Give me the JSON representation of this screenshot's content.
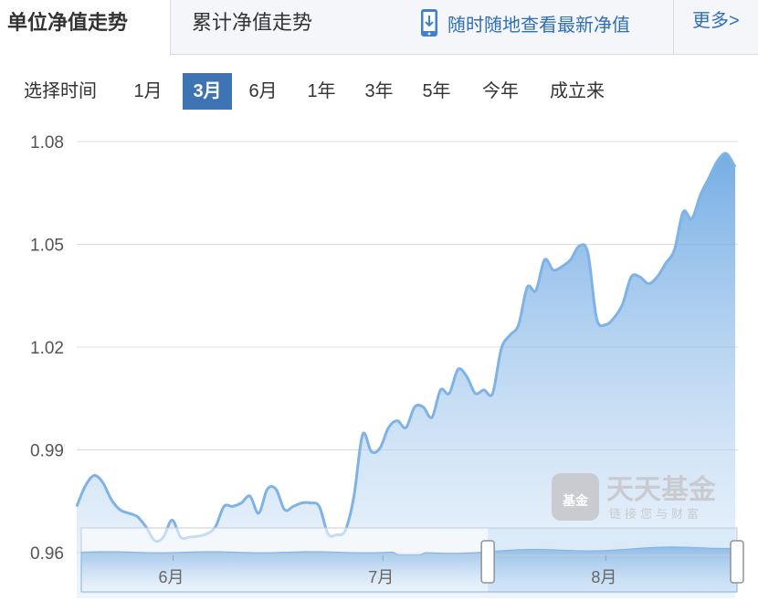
{
  "tabs": [
    {
      "label": "单位净值走势"
    },
    {
      "label": "累计净值走势"
    }
  ],
  "app_link": {
    "label": "随时随地查看最新净值",
    "icon": "phone-download-icon"
  },
  "more": {
    "label": "更多>"
  },
  "time_selector": {
    "label": "选择时间",
    "options": [
      "1月",
      "3月",
      "6月",
      "1年",
      "3年",
      "5年",
      "今年",
      "成立来"
    ],
    "selected": "3月"
  },
  "watermark": {
    "title": "天天基金",
    "slogan": "链接您与财富",
    "badge": "基金"
  },
  "colors": {
    "line": "#7fb2e5",
    "area_top": "#5d9fe0",
    "selected": "#3e74b3",
    "link": "#2f6fb6"
  },
  "chart_data": {
    "type": "area",
    "title": "",
    "xlabel": "",
    "ylabel": "",
    "ylim": [
      0.955,
      1.085
    ],
    "yticks": [
      0.96,
      0.99,
      1.02,
      1.05,
      1.08
    ],
    "ytick_labels": [
      "0.96",
      "0.99",
      "1.02",
      "1.05",
      "1.08"
    ],
    "x_month_labels": [
      "6月",
      "7月",
      "8月"
    ],
    "grid": true,
    "series": [
      {
        "values": [
          0.9735,
          0.9795,
          0.9825,
          0.9805,
          0.9755,
          0.9725,
          0.9715,
          0.9705,
          0.9675,
          0.9635,
          0.9645,
          0.9695,
          0.9645,
          0.9645,
          0.9648,
          0.9655,
          0.9675,
          0.9735,
          0.9735,
          0.9745,
          0.9765,
          0.9715,
          0.9785,
          0.9785,
          0.9725,
          0.9735,
          0.9745,
          0.9745,
          0.9735,
          0.9655,
          0.9652,
          0.9665,
          0.9765,
          0.9945,
          0.9895,
          0.9905,
          0.9965,
          0.9985,
          0.9965,
          1.0025,
          1.0025,
          0.9995,
          1.0075,
          1.0065,
          1.0135,
          1.0115,
          1.0065,
          1.0075,
          1.0065,
          1.0195,
          1.0235,
          1.0265,
          1.0375,
          1.0365,
          1.0455,
          1.0425,
          1.0435,
          1.0455,
          1.0495,
          1.0475,
          1.0285,
          1.0265,
          1.0285,
          1.0325,
          1.0405,
          1.0405,
          1.0385,
          1.0405,
          1.0445,
          1.0485,
          1.0595,
          1.0575,
          1.0645,
          1.0695,
          1.0745,
          1.0765,
          1.0725
        ]
      }
    ]
  },
  "navigator": {
    "month_labels": [
      "6月",
      "7月",
      "8月"
    ],
    "window_start": 0.62,
    "window_end": 1.0
  }
}
